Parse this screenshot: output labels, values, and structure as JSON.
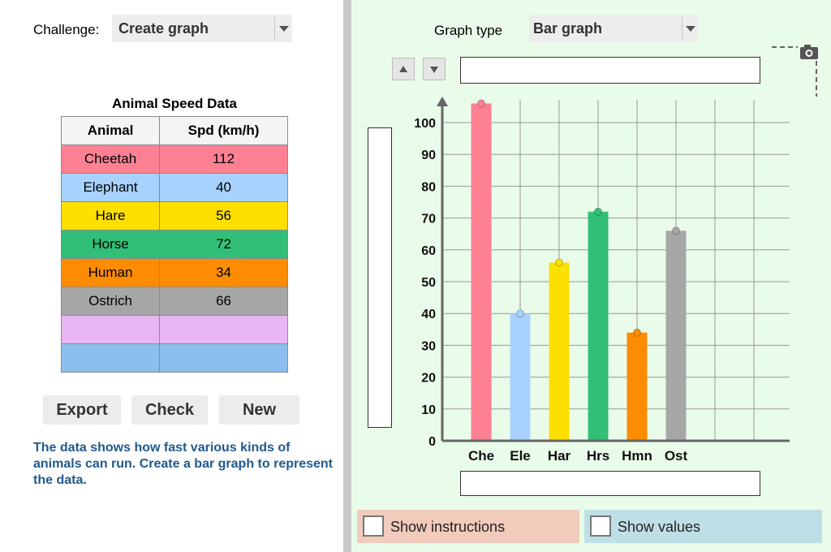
{
  "challenge": {
    "label": "Challenge:",
    "value": "Create graph"
  },
  "table": {
    "title": "Animal Speed Data",
    "headers": [
      "Animal",
      "Spd (km/h)"
    ],
    "rows": [
      {
        "animal": "Cheetah",
        "speed": "112",
        "color": "#fd8193"
      },
      {
        "animal": "Elephant",
        "speed": "40",
        "color": "#a7d2fd"
      },
      {
        "animal": "Hare",
        "speed": "56",
        "color": "#fde000"
      },
      {
        "animal": "Horse",
        "speed": "72",
        "color": "#31bf77"
      },
      {
        "animal": "Human",
        "speed": "34",
        "color": "#fe8c00"
      },
      {
        "animal": "Ostrich",
        "speed": "66",
        "color": "#a6a6a6"
      },
      {
        "animal": "",
        "speed": "",
        "color": "#e8b6f2"
      },
      {
        "animal": "",
        "speed": "",
        "color": "#8cbff0"
      }
    ]
  },
  "buttons": {
    "export": "Export",
    "check": "Check",
    "new": "New"
  },
  "description": "The data shows how fast various kinds of animals can run. Create a bar graph to represent the data.",
  "graph_type": {
    "label": "Graph type",
    "value": "Bar graph"
  },
  "icons": {
    "camera": "camera-icon",
    "up": "up-arrow-icon",
    "down": "down-arrow-icon",
    "dropdown": "chevron-down-icon"
  },
  "toggles": {
    "instructions": "Show instructions",
    "values": "Show values"
  },
  "toggle_colors": {
    "instructions": "#f1cbbb",
    "values": "#bfdfe6"
  },
  "chart_data": {
    "type": "bar",
    "title": "",
    "xlabel": "",
    "ylabel": "",
    "categories": [
      "Che",
      "Ele",
      "Har",
      "Hrs",
      "Hmn",
      "Ost"
    ],
    "values": [
      106,
      40,
      56,
      72,
      34,
      66
    ],
    "colors": [
      "#fd8193",
      "#a7d2fd",
      "#fde000",
      "#31bf77",
      "#fe8c00",
      "#a6a6a6"
    ],
    "ylim": [
      0,
      100
    ],
    "yticks": [
      0,
      10,
      20,
      30,
      40,
      50,
      60,
      70,
      80,
      90,
      100
    ],
    "grid": true
  }
}
